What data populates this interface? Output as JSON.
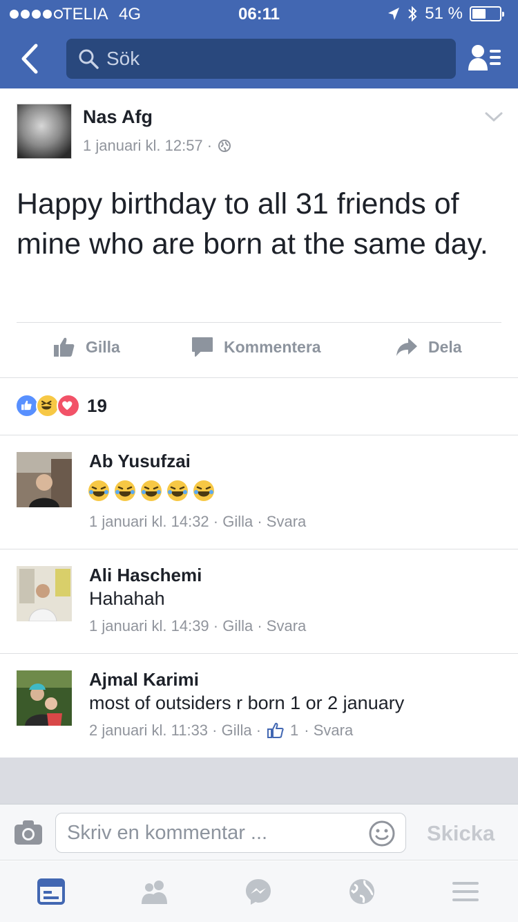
{
  "status_bar": {
    "carrier": "TELIA",
    "network": "4G",
    "time": "06:11",
    "battery_text": "51 %",
    "battery_level": 0.51
  },
  "nav": {
    "search_placeholder": "Sök"
  },
  "post": {
    "author": "Nas Afg",
    "date": "1 januari kl. 12:57 ·",
    "text": "Happy birthday to all 31 friends of mine who are born at the same day.",
    "actions": {
      "like": "Gilla",
      "comment": "Kommentera",
      "share": "Dela"
    },
    "reaction_count": "19",
    "reaction_types": [
      "like",
      "haha",
      "love"
    ]
  },
  "comments": [
    {
      "name": "Ab Yusufzai",
      "emoji": [
        "haha-cry-icon",
        "haha-cry-icon",
        "haha-cry-icon",
        "haha-cry-icon",
        "haha-cry-icon"
      ],
      "meta": "1 januari kl. 14:32 · Gilla · Svara"
    },
    {
      "name": "Ali Haschemi",
      "text": "Hahahah",
      "meta": "1 januari kl. 14:39 · Gilla · Svara"
    },
    {
      "name": "Ajmal Karimi",
      "text": "most of outsiders r born 1 or 2 january",
      "meta_before": "2 januari kl. 11:33 · Gilla ·",
      "like_count": "1",
      "meta_after": "· Svara"
    }
  ],
  "composer": {
    "placeholder": "Skriv en kommentar ...",
    "send": "Skicka"
  },
  "colors": {
    "brand": "#4267b2",
    "text": "#1d2129",
    "muted": "#90949c",
    "like_blue": "#5890ff",
    "love_red": "#f25268",
    "haha_yellow": "#f7c845"
  }
}
